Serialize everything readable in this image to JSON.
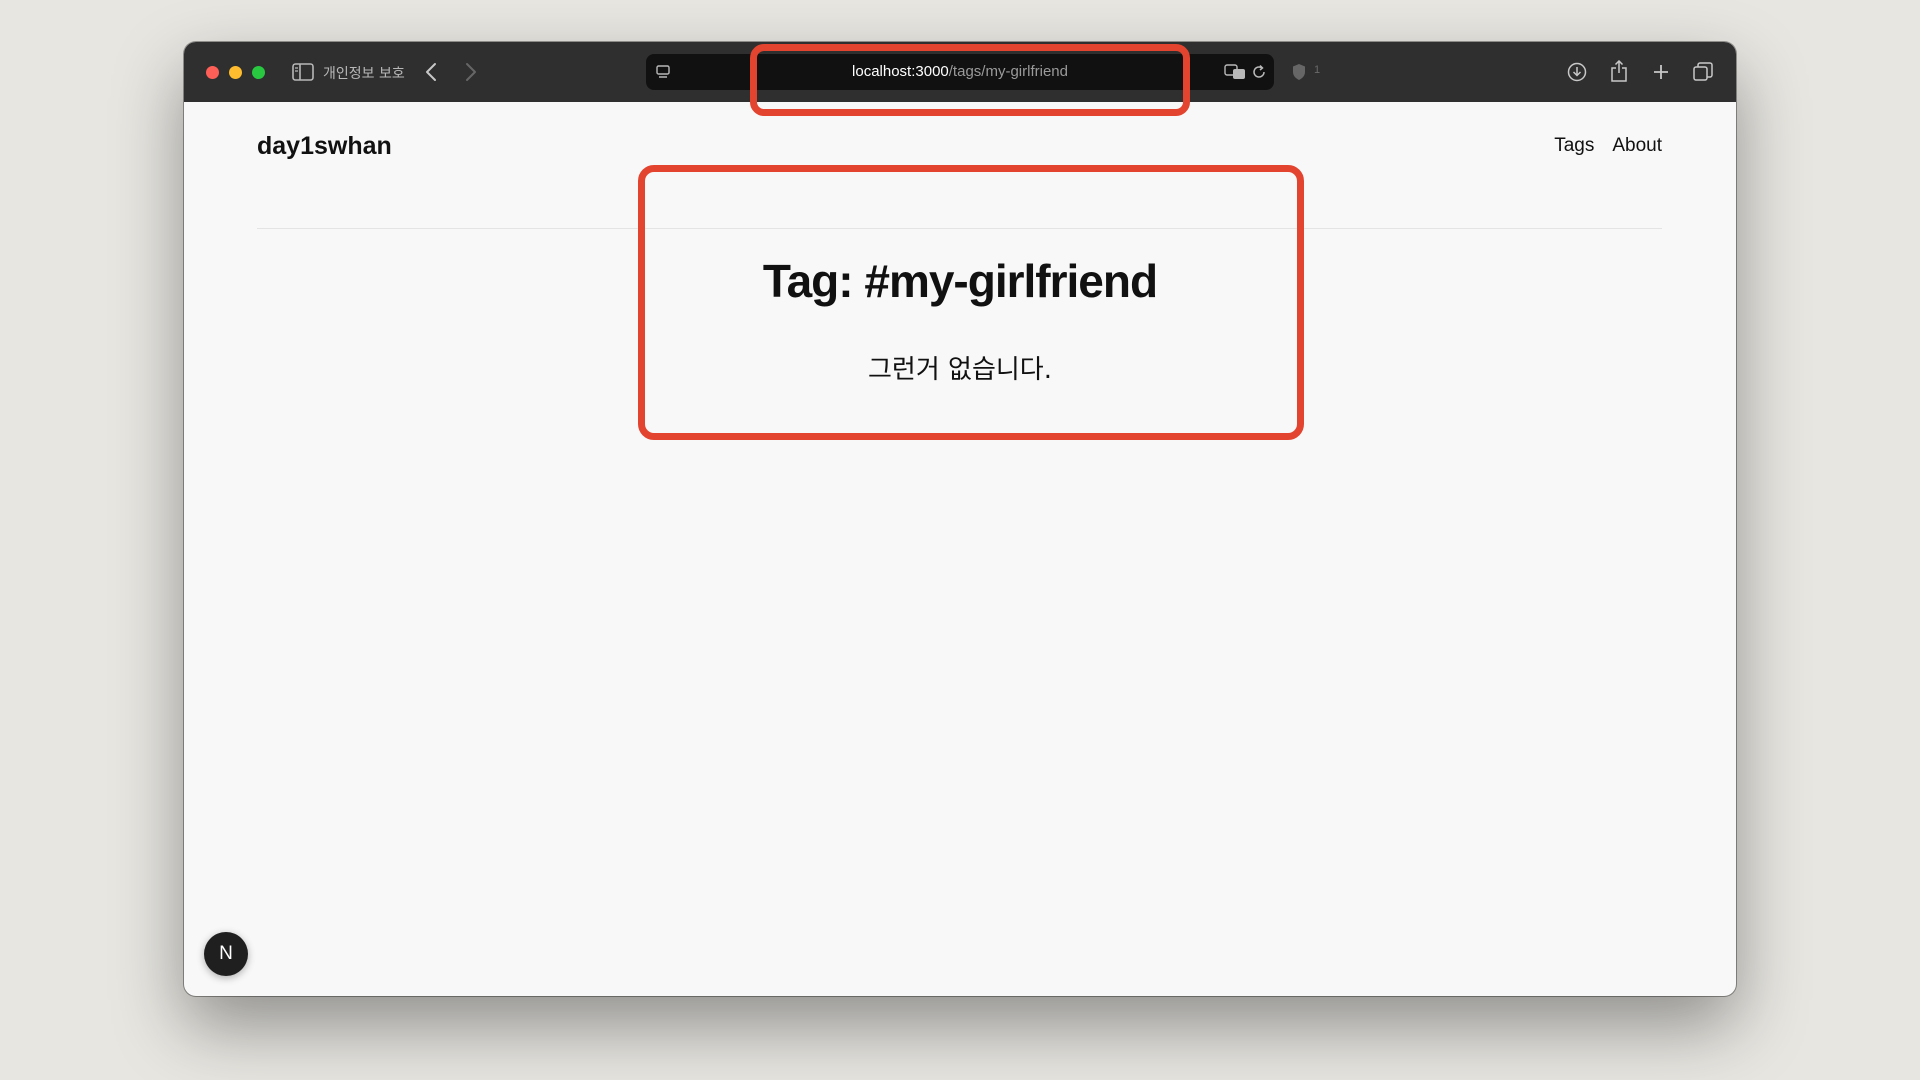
{
  "browser": {
    "privacy_label": "개인정보 보호",
    "url_host": "localhost:3000",
    "url_path": "/tags/my-girlfriend",
    "tab_count": "1",
    "icons": [
      "sidebar-icon",
      "back-icon",
      "forward-icon",
      "page-icon",
      "translate-icon",
      "reload-icon",
      "shield-icon",
      "download-icon",
      "share-icon",
      "new-tab-icon",
      "tab-overview-icon"
    ]
  },
  "site": {
    "title": "day1swhan",
    "nav": [
      {
        "label": "Tags"
      },
      {
        "label": "About"
      }
    ]
  },
  "main": {
    "heading": "Tag: #my-girlfriend",
    "empty_message": "그런거 없습니다."
  },
  "devtools": {
    "badge": "N"
  },
  "colors": {
    "annotation": "#e2442f",
    "toolbar": "#2f2f2f",
    "page_background": "#f8f8f8"
  }
}
